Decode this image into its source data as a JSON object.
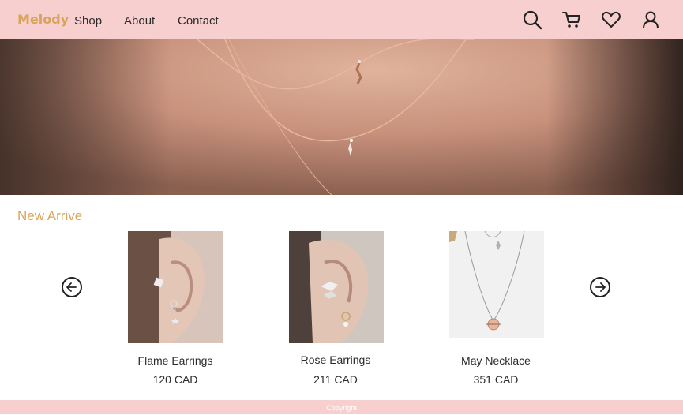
{
  "brand": {
    "name": "Melody"
  },
  "nav": {
    "items": [
      {
        "label": "Shop"
      },
      {
        "label": "About"
      },
      {
        "label": "Contact"
      }
    ]
  },
  "header_icons": [
    "search-icon",
    "cart-icon",
    "heart-icon",
    "user-icon"
  ],
  "hero": {
    "image": "woman-wearing-rose-gold-necklaces"
  },
  "section": {
    "title": "New Arrive",
    "prev_icon": "arrow-left-circle-icon",
    "next_icon": "arrow-right-circle-icon"
  },
  "products": [
    {
      "name": "Flame Earrings",
      "price": "120 CAD",
      "image": "ear-with-earrings"
    },
    {
      "name": "Rose Earrings",
      "price": "211 CAD",
      "image": "ear-with-earrings"
    },
    {
      "name": "May Necklace",
      "price": "351 CAD",
      "image": "necklace-on-white"
    }
  ],
  "footer": {
    "text": "Copyright"
  },
  "colors": {
    "header_bg": "#f8cfcf",
    "accent": "#d9a45a",
    "footer_bg": "#f8cfcf"
  }
}
